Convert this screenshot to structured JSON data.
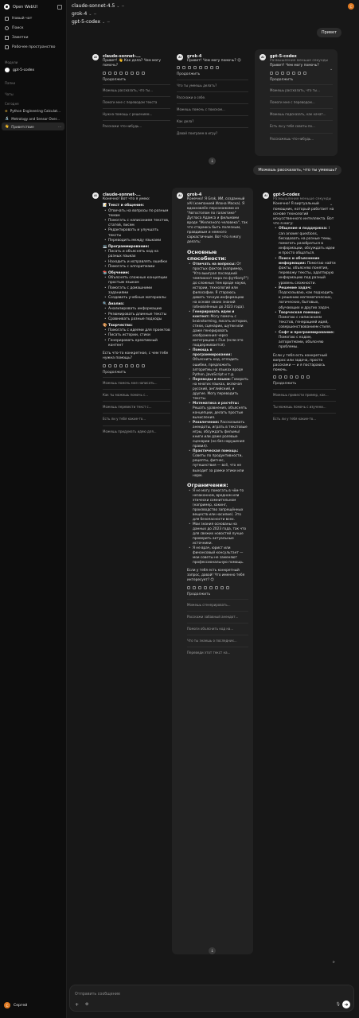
{
  "sidebar": {
    "app_name": "Open WebUI",
    "nav": [
      {
        "label": "Новый чат",
        "icon": "edit-icon"
      },
      {
        "label": "Поиск",
        "icon": "search-icon"
      },
      {
        "label": "Заметки",
        "icon": "notes-icon"
      },
      {
        "label": "Рабочее пространство",
        "icon": "workspace-icon"
      }
    ],
    "models_label": "Модели",
    "model_item": "gpt-5-codex",
    "folders_label": "Папки",
    "chats_label": "Чаты",
    "today_label": "Сегодня",
    "chats": [
      "Python Engineering Calculat...",
      "Metrology and Sensor Over...",
      "Приветствие"
    ],
    "user_name": "Сергей",
    "user_initial": "С"
  },
  "header": {
    "models": [
      "claude-sonnet-4.5",
      "grok-4",
      "gpt-5-codex"
    ],
    "avatar_initial": "С"
  },
  "messages": {
    "user1": "Привет",
    "user2": "Можешь рассказать, что ты умеешь?",
    "continue_label": "Продолжить",
    "r1": {
      "claude": {
        "name": "claude-sonnet-...",
        "text": "Привет! 👋 Как дела? Чем могу помочь?",
        "followups": [
          "Можешь рассказать, что ты...",
          "Помоги мне с переводом текста",
          "Нужна помощь с решением...",
          "Расскажи что-нибудь..."
        ]
      },
      "grok": {
        "name": "grok-4",
        "text": "Привет! Чем могу помочь? 😊",
        "followups": [
          "Что ты умеешь делать?",
          "Расскажи о себе.",
          "Можешь помочь с поиском...",
          "Как дела?",
          "Давай поиграем в игру?"
        ]
      },
      "gpt": {
        "name": "gpt-5-codex",
        "thinking": "Размышление меньше секунды",
        "text": "Привет! Чем могу помочь?",
        "followups": [
          "Можешь рассказать, что ты...",
          "Помоги мне с переводом...",
          "Можешь подсказать, как начат...",
          "Есть ли у тебя советы по...",
          "Расскажешь что-нибудь..."
        ]
      }
    },
    "r2": {
      "claude": {
        "name": "claude-sonnet-...",
        "intro": "Конечно! Вот что я умею:",
        "sections": [
          {
            "title": "📝 Текст и общение:",
            "items": [
              "Отвечать на вопросы по разным темам",
              "Помогать с написанием текстов, статей, писем",
              "Редактировать и улучшать тексты",
              "Переводить между языками"
            ]
          },
          {
            "title": "💻 Программирование:",
            "items": [
              "Писать и объяснять код на разных языках",
              "Находить и исправлять ошибки",
              "Помогать с алгоритмами"
            ]
          },
          {
            "title": "📚 Обучение:",
            "items": [
              "Объяснять сложные концепции простым языком",
              "Помогать с домашними заданиями",
              "Создавать учебные материалы"
            ]
          },
          {
            "title": "🔍 Анализ:",
            "items": [
              "Анализировать информацию",
              "Резюмировать длинные тексты",
              "Сравнивать разные подходы"
            ]
          },
          {
            "title": "🎨 Творчество:",
            "items": [
              "Помогать с идеями для проектов",
              "Писать истории, стихи",
              "Генерировать креативный контент"
            ]
          }
        ],
        "outro": "Есть что-то конкретное, с чем тебе нужна помощь?",
        "followups": [
          "Можешь помочь мне написать...",
          "Как ты можешь помочь с...",
          "Можешь перевести текст с...",
          "Есть ли у тебя какие-то...",
          "Можешь придумать идею для..."
        ]
      },
      "grok": {
        "name": "grok-4",
        "intro": "Конечно! Я Grok, ИИ, созданный xAI (компанией Илона Маска). Я вдохновлён персонажами из \"Автостопом по галактике\" Дугласа Адамса и фильмами вроде \"Железного человека\", так что стараюсь быть полезным, правдивым и немного саркастичным. Вот что я могу делать:",
        "heading1": "Основные способности:",
        "abilities": [
          {
            "b": "Отвечать на вопросы:",
            "t": "От простых фактов (например, \"Кто выиграл последний чемпионат мира по футболу?\") до сложных тем вроде науки, истории, технологий или философии. Я стараюсь давать точную информацию на основе своих знаний (обновлённых до 2023 года)."
          },
          {
            "b": "Генерировать идеи и контент:",
            "t": "Могу помочь с brainstorming, писать истории, стихи, сценарии, шутки или даже генерировать изображения через интеграцию с Flux (если это поддерживается)."
          },
          {
            "b": "Помощь в программировании:",
            "t": "Объяснить код, отладить ошибки, предложить алгоритмы на языках вроде Python, JavaScript и т.д."
          },
          {
            "b": "Переводы и языки:",
            "t": "Говорить на многих языках, включая русский, английский, и другие. Могу переводить тексты."
          },
          {
            "b": "Математика и расчёты:",
            "t": "Решать уравнения, объяснять концепции, делать простые вычисления."
          },
          {
            "b": "Развлечения:",
            "t": "Рассказывать анекдоты, играть в текстовые игры, обсуждать фильмы/книги или даже ролевые сценарии (но без нарушения правил)."
          },
          {
            "b": "Практическая помощь:",
            "t": "Советы по продуктивности, рецепты, фитнес, путешествия — всё, что не выходит за рамки этики или норм."
          }
        ],
        "heading2": "Ограничения:",
        "limits": [
          "Я не могу помогать в чём-то незаконном, вредном или этически сомнительном (например, хакинг, производство запрещённых веществ или насилие). Это для безопасности всех.",
          "Мои знания основаны на данных до 2023 года, так что для свежих новостей лучше проверить актуальные источники.",
          "Я не врач, юрист или финансовый консультант — мои советы не заменяют профессиональную помощь."
        ],
        "outro": "Если у тебя есть конкретный запрос, давай! Что именно тебя интересует? 😊",
        "followups": [
          "Можешь сгенерировать...",
          "Расскажи забавный анекдот...",
          "Помоги объяснить код на...",
          "Что ты знаешь о последних...",
          "Переведи этот текст на..."
        ]
      },
      "gpt": {
        "name": "gpt-5-codex",
        "thinking": "Размышление меньше секунды",
        "intro": "Конечно! Я виртуальный помощник, который работает на основе технологий искусственного интеллекта. Вот что я могу:",
        "items": [
          {
            "b": "Общение и поддержка:",
            "t": "I can answer questions, беседовать на разные темы, помогать разобраться в информации, обсуждать идеи и просто общаться."
          },
          {
            "b": "Поиск и объяснение информации:",
            "t": "Помогаю найти факты, объясняю понятия, перевожу тексты, адаптирую информацию под разный уровень сложности."
          },
          {
            "b": "Решение задач:",
            "t": "Подсказываю, как подходить к решению математических, логических, бытовых, обучающих и других задач."
          },
          {
            "b": "Творческая помощь:",
            "t": "Помогаю с написанием текстов, генерацией идей, совершенствованием стиля."
          },
          {
            "b": "Софт и программирование:",
            "t": "Помогаю с кодом, алгоритмами, объясняю проблемы."
          }
        ],
        "outro": "Если у тебя есть конкретный вопрос или задача, просто расскажи — и я постараюсь помочь.",
        "followups": [
          "Можешь привести пример, как...",
          "Ты можешь помочь с изучени...",
          "Есть ли у тебя какие-то..."
        ]
      }
    }
  },
  "composer": {
    "placeholder": "Отправить сообщение"
  }
}
